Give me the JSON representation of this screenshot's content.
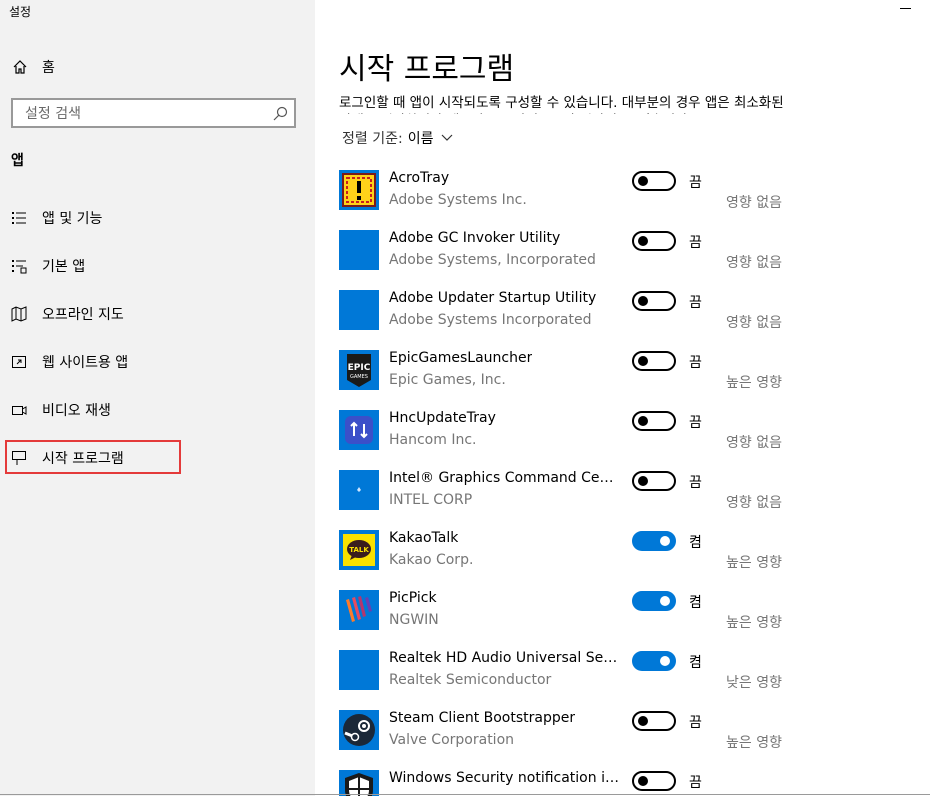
{
  "window": {
    "title": "설정"
  },
  "sidebar": {
    "home_label": "홈",
    "search_placeholder": "설정 검색",
    "section_title": "앱",
    "items": [
      {
        "label": "앱 및 기능",
        "icon": "apps-features-icon"
      },
      {
        "label": "기본 앱",
        "icon": "default-apps-icon"
      },
      {
        "label": "오프라인 지도",
        "icon": "offline-maps-icon"
      },
      {
        "label": "웹 사이트용 앱",
        "icon": "apps-for-websites-icon"
      },
      {
        "label": "비디오 재생",
        "icon": "video-playback-icon"
      },
      {
        "label": "시작 프로그램",
        "icon": "startup-icon",
        "selected": true
      }
    ]
  },
  "main": {
    "title": "시작 프로그램",
    "description": "로그인할 때 앱이 시작되도록 구성할 수 있습니다. 대부분의 경우 앱은 최소화된 상태로 시작하거나 백그라운드 작업으로만 시작될 수 있습니다.",
    "sort": {
      "prefix": "정렬 기준:",
      "value": "이름"
    },
    "apps": [
      {
        "name": "AcroTray",
        "publisher": "Adobe Systems Inc.",
        "state": "끔",
        "on": false,
        "impact": "영향 없음",
        "icon": "acrotray-icon"
      },
      {
        "name": "Adobe GC Invoker Utility",
        "publisher": "Adobe Systems, Incorporated",
        "state": "끔",
        "on": false,
        "impact": "영향 없음",
        "icon": "blank-app-icon"
      },
      {
        "name": "Adobe Updater Startup Utility",
        "publisher": "Adobe Systems Incorporated",
        "state": "끔",
        "on": false,
        "impact": "영향 없음",
        "icon": "blank-app-icon"
      },
      {
        "name": "EpicGamesLauncher",
        "publisher": "Epic Games, Inc.",
        "state": "끔",
        "on": false,
        "impact": "높은 영향",
        "icon": "epic-games-icon"
      },
      {
        "name": "HncUpdateTray",
        "publisher": "Hancom Inc.",
        "state": "끔",
        "on": false,
        "impact": "영향 없음",
        "icon": "hnc-update-icon"
      },
      {
        "name": "Intel® Graphics Command Center…",
        "publisher": "INTEL CORP",
        "state": "끔",
        "on": false,
        "impact": "영향 없음",
        "icon": "intel-graphics-icon"
      },
      {
        "name": "KakaoTalk",
        "publisher": "Kakao Corp.",
        "state": "켬",
        "on": true,
        "impact": "높은 영향",
        "icon": "kakaotalk-icon"
      },
      {
        "name": "PicPick",
        "publisher": "NGWIN",
        "state": "켬",
        "on": true,
        "impact": "높은 영향",
        "icon": "picpick-icon"
      },
      {
        "name": "Realtek HD Audio Universal Service",
        "publisher": "Realtek Semiconductor",
        "state": "켬",
        "on": true,
        "impact": "낮은 영향",
        "icon": "blank-app-icon"
      },
      {
        "name": "Steam Client Bootstrapper",
        "publisher": "Valve Corporation",
        "state": "끔",
        "on": false,
        "impact": "높은 영향",
        "icon": "steam-icon"
      },
      {
        "name": "Windows Security notification icon",
        "publisher": "",
        "state": "끔",
        "on": false,
        "impact": "",
        "icon": "windows-security-icon"
      }
    ]
  },
  "icon_text": {
    "epic_top": "EPIC",
    "epic_bottom": "GAMES",
    "kakao": "TALK"
  },
  "colors": {
    "accent": "#0078d7",
    "app_tile_blue": "#0078d7",
    "sidebar_bg": "#f2f2f2",
    "highlight_red": "#e43a3a",
    "secondary_text": "#767676"
  }
}
